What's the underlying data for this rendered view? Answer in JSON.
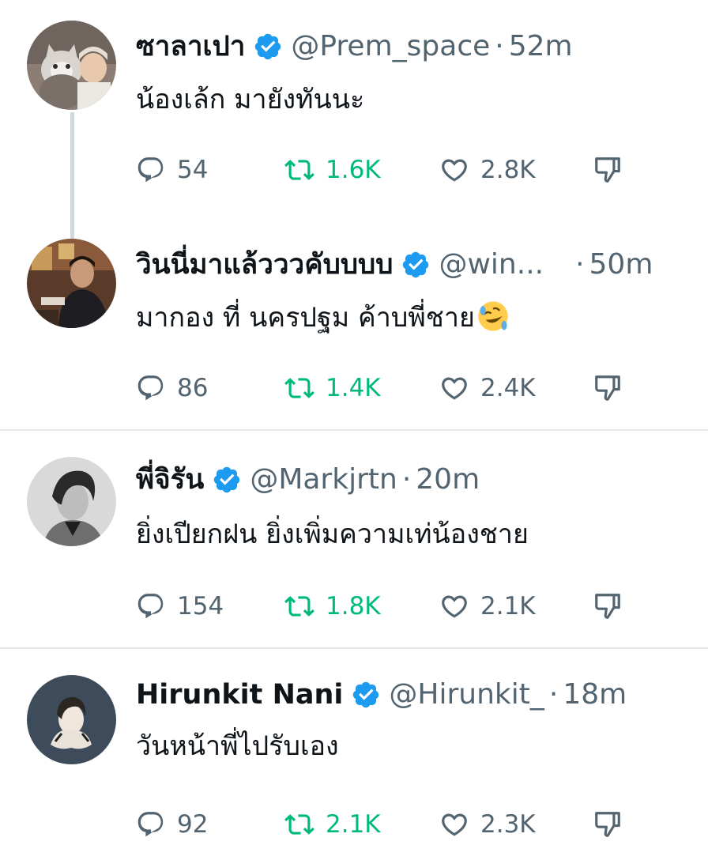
{
  "colors": {
    "verified": "#1d9bf0",
    "retweet": "#00ba7c",
    "secondary_text": "#536471",
    "primary_text": "#0f1419",
    "divider": "#e4e8eb",
    "thread_line": "#cfd9de"
  },
  "separator": "·",
  "tweets": [
    {
      "name": "ซาลาเปา",
      "handle": "@Prem_space",
      "time": "52m",
      "text": "น้องเล้ก มายังทันนะ",
      "avatar_icon": "avatar-man-with-cat-icon",
      "replies": "54",
      "retweets": "1.6K",
      "likes": "2.8K"
    },
    {
      "name": "วินนี่มาแล้ววว​คับบบบ",
      "handle": "@win...",
      "time": "50m",
      "text": "มากอง ที่ นครปฐม ค้าบพี่ชาย",
      "emoji_icon": "rolling-on-floor-laughing-emoji",
      "avatar_icon": "avatar-man-seated-icon",
      "replies": "86",
      "retweets": "1.4K",
      "likes": "2.4K"
    },
    {
      "name": "พี่จิรัน",
      "handle": "@Markjrtn",
      "time": "20m",
      "text": "ยิ่งเปียกฝน ยิ่งเพิ่มความเท่น้องชาย",
      "avatar_icon": "avatar-monochrome-portrait-icon",
      "replies": "154",
      "retweets": "1.8K",
      "likes": "2.1K"
    },
    {
      "name": "Hirunkit Nani",
      "handle": "@Hirunkit_",
      "time": "18m",
      "text": "วันหน้าพี่ไปรับเอง",
      "avatar_icon": "avatar-illustrated-portrait-icon",
      "replies": "92",
      "retweets": "2.1K",
      "likes": "2.3K"
    }
  ]
}
